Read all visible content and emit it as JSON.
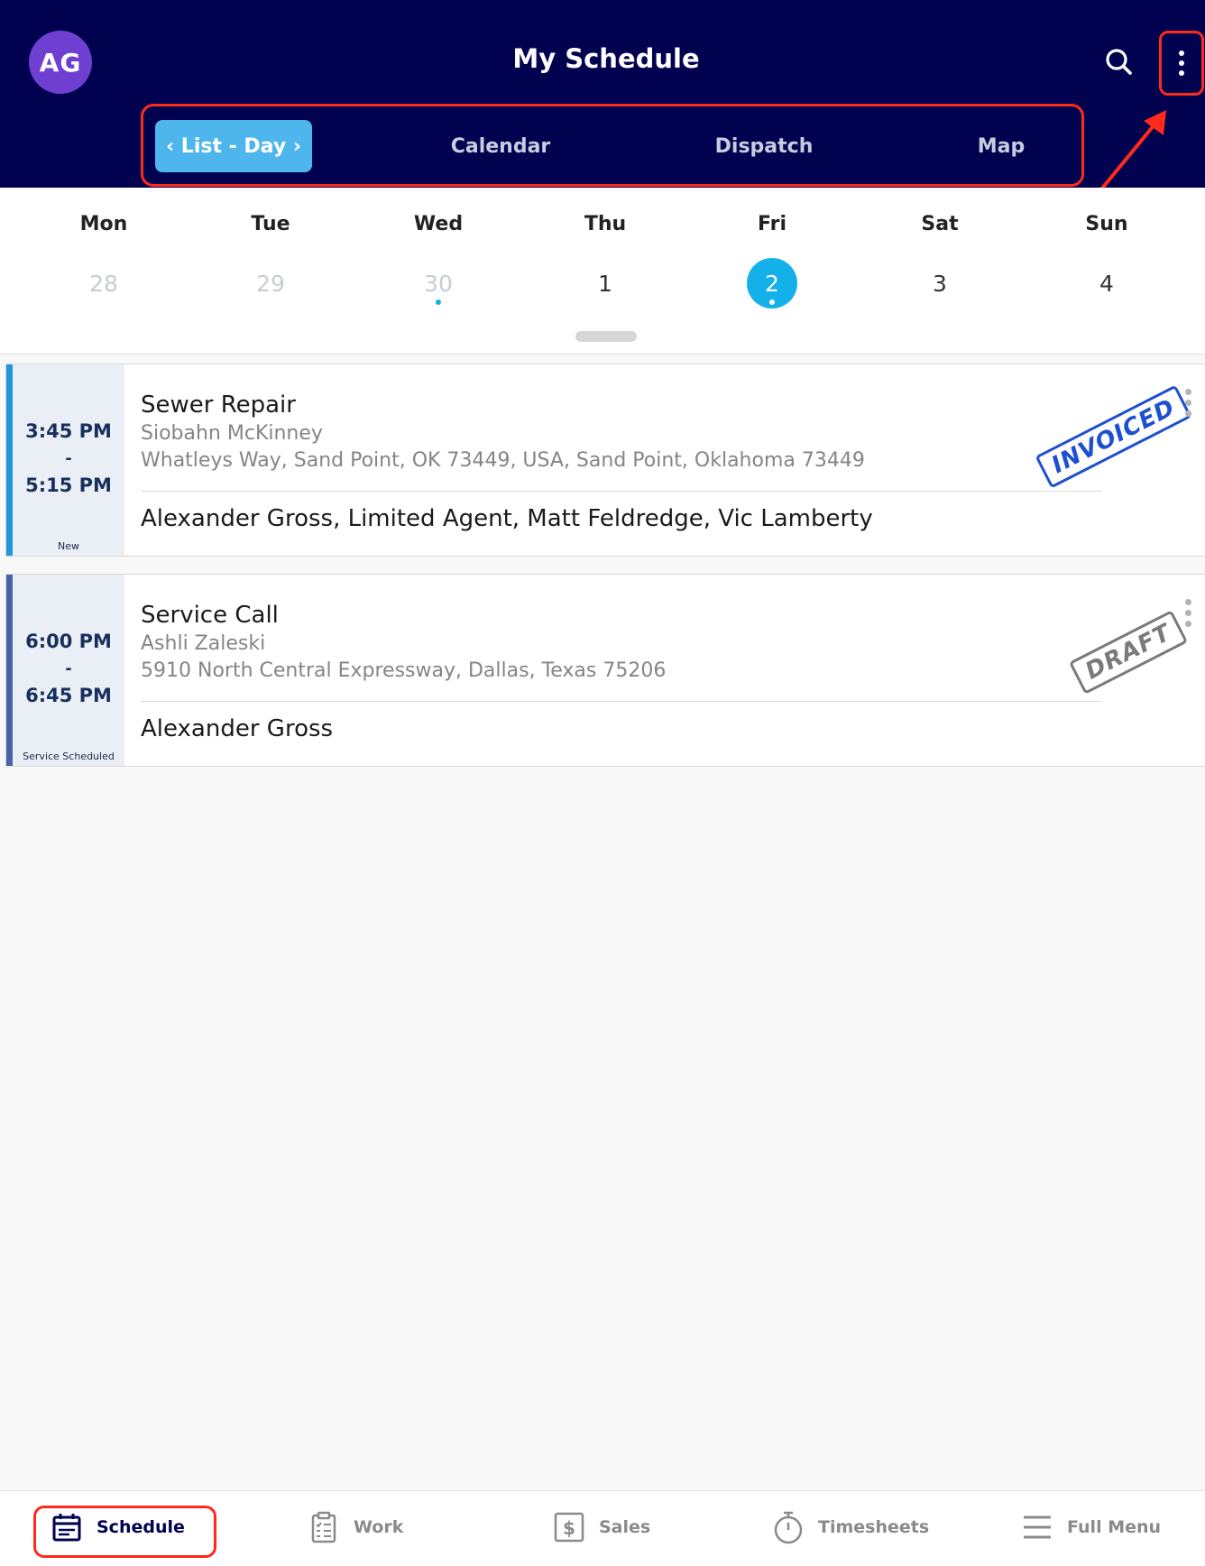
{
  "header": {
    "avatar_initials": "AG",
    "title": "My Schedule",
    "search_icon": "search-icon",
    "more_icon": "more-vertical-icon"
  },
  "view_tabs": [
    {
      "label": "‹ List - Day ›",
      "active": true
    },
    {
      "label": "Calendar",
      "active": false
    },
    {
      "label": "Dispatch",
      "active": false
    },
    {
      "label": "Map",
      "active": false
    }
  ],
  "week": {
    "days": [
      {
        "name": "Mon",
        "num": "28",
        "state": "past",
        "has_jobs": false
      },
      {
        "name": "Tue",
        "num": "29",
        "state": "past",
        "has_jobs": false
      },
      {
        "name": "Wed",
        "num": "30",
        "state": "past",
        "has_jobs": true
      },
      {
        "name": "Thu",
        "num": "1",
        "state": "normal",
        "has_jobs": false
      },
      {
        "name": "Fri",
        "num": "2",
        "state": "selected",
        "has_jobs": true
      },
      {
        "name": "Sat",
        "num": "3",
        "state": "normal",
        "has_jobs": false
      },
      {
        "name": "Sun",
        "num": "4",
        "state": "normal",
        "has_jobs": false
      }
    ]
  },
  "jobs": [
    {
      "start": "3:45 PM",
      "separator": "-",
      "end": "5:15 PM",
      "status": "New",
      "stripe_color": "#1e98d8",
      "title": "Sewer Repair",
      "customer": "Siobahn McKinney",
      "address": "Whatleys Way, Sand Point, OK 73449, USA, Sand Point, Oklahoma 73449",
      "crew": "Alexander Gross, Limited Agent, Matt Feldredge, Vic Lamberty",
      "stamp": "INVOICED"
    },
    {
      "start": "6:00 PM",
      "separator": "-",
      "end": "6:45 PM",
      "status": "Service Scheduled",
      "stripe_color": "#4a63a5",
      "title": "Service Call",
      "customer": "Ashli Zaleski",
      "address": "5910 North Central Expressway, Dallas, Texas 75206",
      "crew": "Alexander Gross",
      "stamp": "DRAFT"
    }
  ],
  "bottom_nav": [
    {
      "label": "Schedule",
      "icon": "calendar-icon",
      "active": true
    },
    {
      "label": "Work",
      "icon": "clipboard-icon",
      "active": false
    },
    {
      "label": "Sales",
      "icon": "dollar-icon",
      "active": false
    },
    {
      "label": "Timesheets",
      "icon": "stopwatch-icon",
      "active": false
    },
    {
      "label": "Full Menu",
      "icon": "menu-icon",
      "active": false
    }
  ],
  "colors": {
    "header_bg": "#01024f",
    "accent": "#14b0ea",
    "annotation": "#ff2a1a"
  }
}
